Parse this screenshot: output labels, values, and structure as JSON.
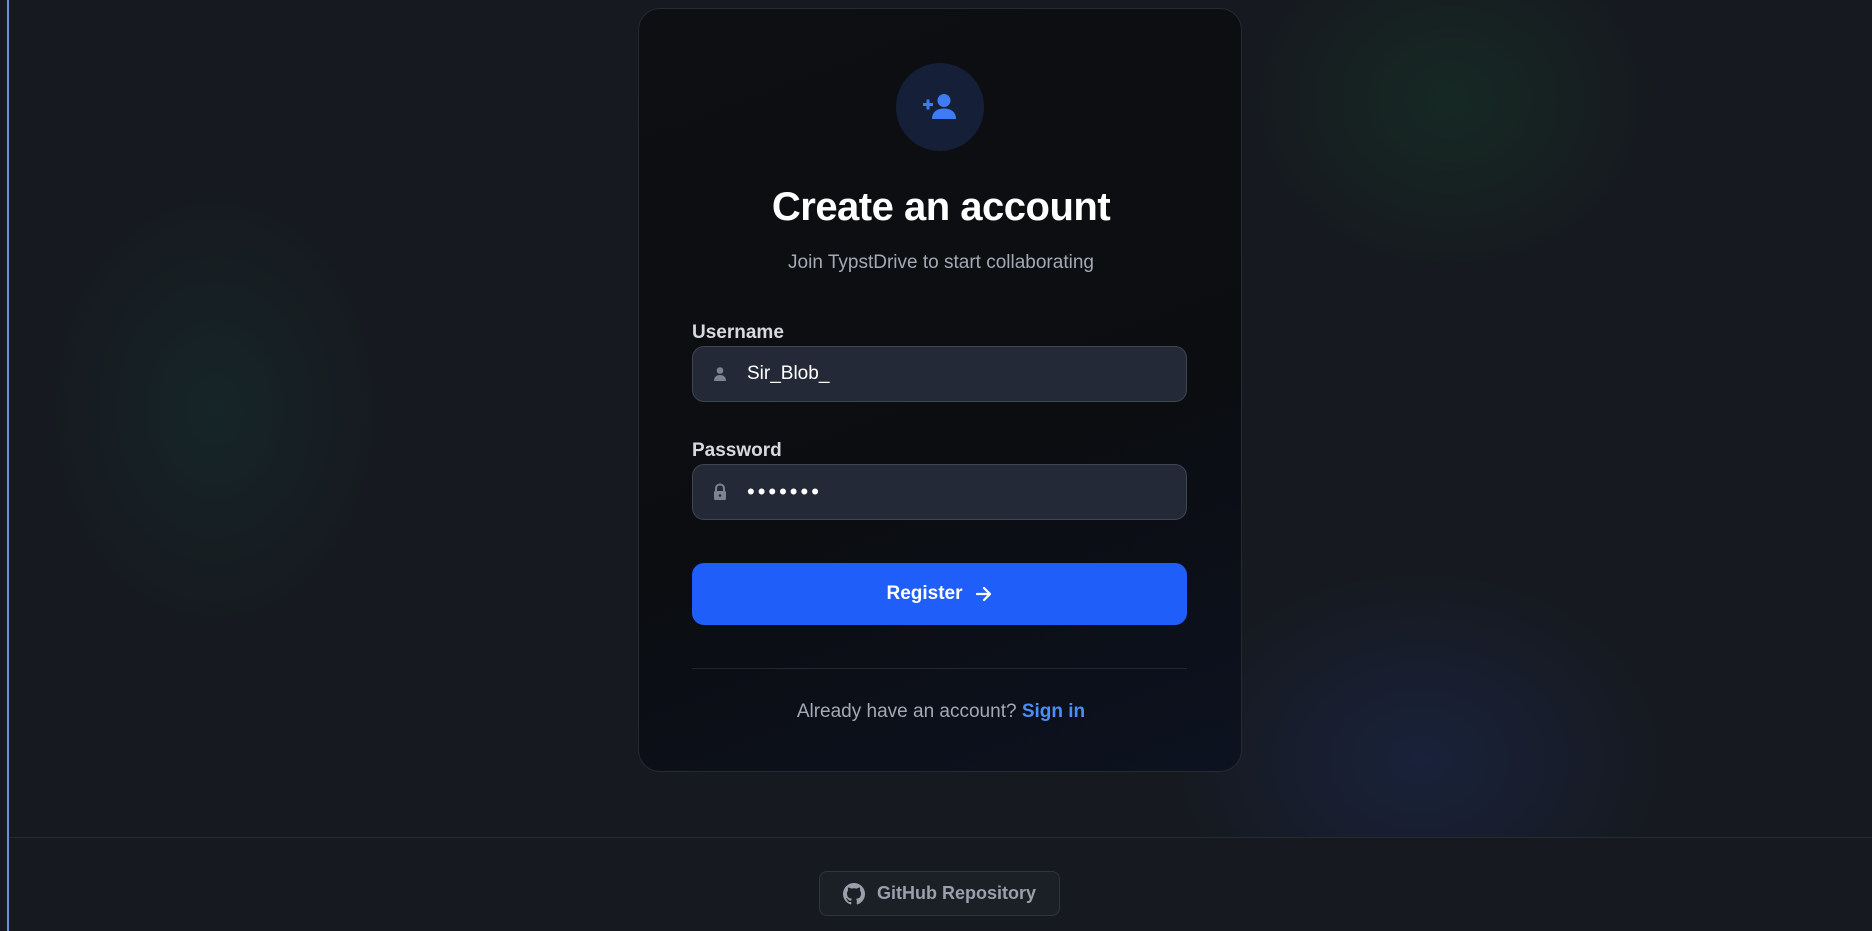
{
  "card": {
    "icon": "user-plus-icon",
    "title": "Create an account",
    "subtitle": "Join TypstDrive to start collaborating"
  },
  "form": {
    "username": {
      "label": "Username",
      "value": "Sir_Blob_",
      "icon": "user-icon"
    },
    "password": {
      "label": "Password",
      "value": "•••••••",
      "icon": "lock-icon"
    },
    "register_label": "Register",
    "register_icon": "arrow-right-icon"
  },
  "signin": {
    "prompt": "Already have an account?",
    "link": "Sign in"
  },
  "footer": {
    "github_label": "GitHub Repository",
    "github_icon": "github-icon"
  },
  "colors": {
    "accent": "#1f5ef8",
    "link": "#4b8ef5",
    "background": "#16191f",
    "card": "#0d0f13"
  }
}
